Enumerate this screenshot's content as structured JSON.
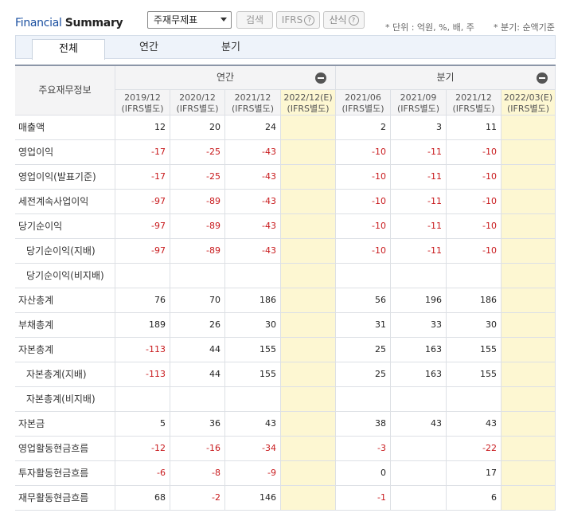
{
  "header": {
    "brand_part1": "Financial",
    "brand_part2": "Summary",
    "select_value": "주재무제표",
    "search_label": "검색",
    "ifrs_label": "IFRS",
    "sansik_label": "산식",
    "help_symbol": "?",
    "unit_note": "* 단위 : 억원, %, 배, 주",
    "quarter_note": "* 분기: 순액기준"
  },
  "tabs": [
    {
      "label": "전체",
      "active": true
    },
    {
      "label": "연간",
      "active": false
    },
    {
      "label": "분기",
      "active": false
    }
  ],
  "table": {
    "corner_label": "주요재무정보",
    "groups": [
      {
        "label": "연간"
      },
      {
        "label": "분기"
      }
    ],
    "columns": [
      {
        "period": "2019/12",
        "basis": "(IFRS별도)",
        "estimate": false
      },
      {
        "period": "2020/12",
        "basis": "(IFRS별도)",
        "estimate": false
      },
      {
        "period": "2021/12",
        "basis": "(IFRS별도)",
        "estimate": false
      },
      {
        "period": "2022/12(E)",
        "basis": "(IFRS별도)",
        "estimate": true
      },
      {
        "period": "2021/06",
        "basis": "(IFRS별도)",
        "estimate": false
      },
      {
        "period": "2021/09",
        "basis": "(IFRS별도)",
        "estimate": false
      },
      {
        "period": "2021/12",
        "basis": "(IFRS별도)",
        "estimate": false
      },
      {
        "period": "2022/03(E)",
        "basis": "(IFRS별도)",
        "estimate": true
      }
    ],
    "rows": [
      {
        "label": "매출액",
        "indent": false,
        "values": [
          "12",
          "20",
          "24",
          "",
          "2",
          "3",
          "11",
          ""
        ]
      },
      {
        "label": "영업이익",
        "indent": false,
        "values": [
          "-17",
          "-25",
          "-43",
          "",
          "-10",
          "-11",
          "-10",
          ""
        ]
      },
      {
        "label": "영업이익(발표기준)",
        "indent": false,
        "values": [
          "-17",
          "-25",
          "-43",
          "",
          "-10",
          "-11",
          "-10",
          ""
        ]
      },
      {
        "label": "세전계속사업이익",
        "indent": false,
        "values": [
          "-97",
          "-89",
          "-43",
          "",
          "-10",
          "-11",
          "-10",
          ""
        ]
      },
      {
        "label": "당기순이익",
        "indent": false,
        "values": [
          "-97",
          "-89",
          "-43",
          "",
          "-10",
          "-11",
          "-10",
          ""
        ]
      },
      {
        "label": "당기순이익(지배)",
        "indent": true,
        "values": [
          "-97",
          "-89",
          "-43",
          "",
          "-10",
          "-11",
          "-10",
          ""
        ]
      },
      {
        "label": "당기순이익(비지배)",
        "indent": true,
        "values": [
          "",
          "",
          "",
          "",
          "",
          "",
          "",
          ""
        ]
      },
      {
        "label": "자산총계",
        "indent": false,
        "values": [
          "76",
          "70",
          "186",
          "",
          "56",
          "196",
          "186",
          ""
        ]
      },
      {
        "label": "부채총계",
        "indent": false,
        "values": [
          "189",
          "26",
          "30",
          "",
          "31",
          "33",
          "30",
          ""
        ]
      },
      {
        "label": "자본총계",
        "indent": false,
        "values": [
          "-113",
          "44",
          "155",
          "",
          "25",
          "163",
          "155",
          ""
        ]
      },
      {
        "label": "자본총계(지배)",
        "indent": true,
        "values": [
          "-113",
          "44",
          "155",
          "",
          "25",
          "163",
          "155",
          ""
        ]
      },
      {
        "label": "자본총계(비지배)",
        "indent": true,
        "values": [
          "",
          "",
          "",
          "",
          "",
          "",
          "",
          ""
        ]
      },
      {
        "label": "자본금",
        "indent": false,
        "values": [
          "5",
          "36",
          "43",
          "",
          "38",
          "43",
          "43",
          ""
        ]
      },
      {
        "label": "영업활동현금흐름",
        "indent": false,
        "values": [
          "-12",
          "-16",
          "-34",
          "",
          "-3",
          "",
          "-22",
          ""
        ]
      },
      {
        "label": "투자활동현금흐름",
        "indent": false,
        "values": [
          "-6",
          "-8",
          "-9",
          "",
          "0",
          "",
          "17",
          ""
        ]
      },
      {
        "label": "재무활동현금흐름",
        "indent": false,
        "values": [
          "68",
          "-2",
          "146",
          "",
          "-1",
          "",
          "6",
          ""
        ]
      }
    ]
  },
  "colors": {
    "brand_blue": "#1a4fa0",
    "negative_red": "#c8191c",
    "estimate_bg": "#fdf7d2",
    "header_bg": "#f4f4f5"
  }
}
